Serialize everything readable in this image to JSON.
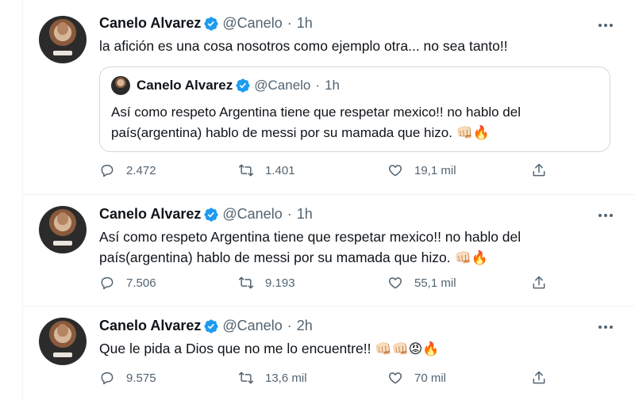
{
  "tweets": [
    {
      "name": "Canelo Alvarez",
      "handle": "@Canelo",
      "separator": "·",
      "time": "1h",
      "text": "la afición es una cosa nosotros como ejemplo otra... no sea tanto!!",
      "quote": {
        "name": "Canelo Alvarez",
        "handle": "@Canelo",
        "separator": "·",
        "time": "1h",
        "line1": "Así como respeto Argentina tiene que respetar mexico!! no hablo del",
        "line2": "país(argentina) hablo de messi por su mamada que hizo.",
        "emojis": "👊🏻🔥"
      },
      "replies": "2.472",
      "retweets": "1.401",
      "likes": "19,1 mil"
    },
    {
      "name": "Canelo Alvarez",
      "handle": "@Canelo",
      "separator": "·",
      "time": "1h",
      "line1": "Así como respeto Argentina tiene que respetar mexico!! no hablo del",
      "line2": "país(argentina) hablo de messi por su mamada que hizo.",
      "emojis": "👊🏻🔥",
      "replies": "7.506",
      "retweets": "9.193",
      "likes": "55,1 mil"
    },
    {
      "name": "Canelo Alvarez",
      "handle": "@Canelo",
      "separator": "·",
      "time": "2h",
      "text": "Que le pida a Dios que no me lo encuentre!!",
      "emojis": "👊🏻👊🏻😡🔥",
      "replies": "9.575",
      "retweets": "13,6 mil",
      "likes": "70 mil"
    }
  ],
  "icons": {
    "verified": "verified-badge-icon",
    "more": "more-options-icon",
    "reply": "reply-icon",
    "retweet": "retweet-icon",
    "like": "heart-icon",
    "share": "share-icon"
  },
  "colors": {
    "verified": "#1d9bf0",
    "secondary_text": "#536471",
    "border": "#cfd9de"
  }
}
